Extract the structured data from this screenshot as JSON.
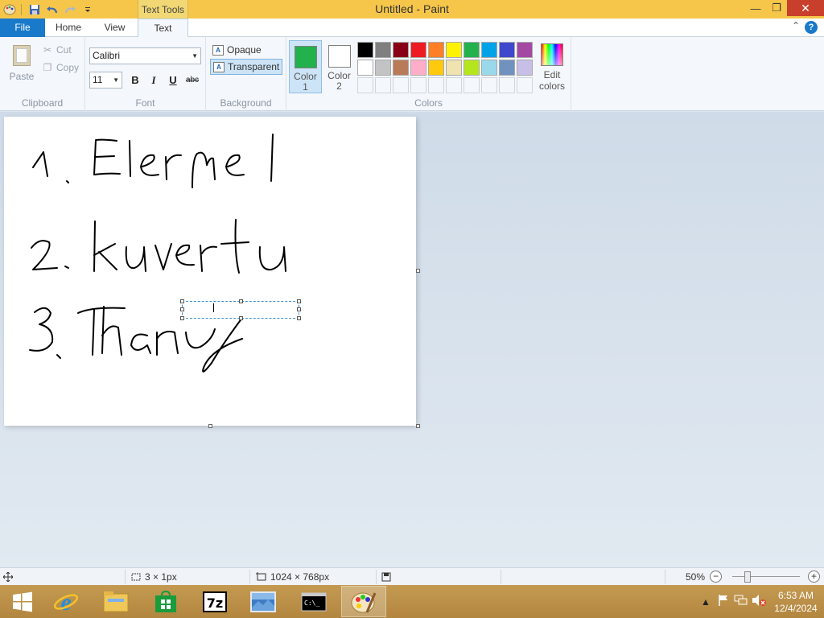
{
  "window": {
    "title": "Untitled - Paint",
    "context_tab_header": "Text Tools",
    "minimize": "—",
    "maximize": "❐",
    "close": "✕"
  },
  "tabs": {
    "file": "File",
    "home": "Home",
    "view": "View",
    "text": "Text",
    "help": "?",
    "collapse": "⌃"
  },
  "ribbon": {
    "clipboard": {
      "label": "Clipboard",
      "paste": "Paste",
      "cut": "Cut",
      "copy": "Copy"
    },
    "font": {
      "label": "Font",
      "name": "Calibri",
      "size": "11",
      "bold": "B",
      "italic": "I",
      "underline": "U",
      "strike": "abc"
    },
    "background": {
      "label": "Background",
      "opaque": "Opaque",
      "transparent": "Transparent"
    },
    "colors": {
      "label": "Colors",
      "color1_label": "Color 1",
      "color1_line1": "Color",
      "color1_line2": "1",
      "color2_line1": "Color",
      "color2_line2": "2",
      "color1": "#22b14c",
      "color2": "#ffffff",
      "edit_line1": "Edit",
      "edit_line2": "colors",
      "palette_row1": [
        "#000000",
        "#7f7f7f",
        "#880015",
        "#ed1c24",
        "#ff7f27",
        "#fff200",
        "#22b14c",
        "#00a2e8",
        "#3f48cc",
        "#a349a4"
      ],
      "palette_row2": [
        "#ffffff",
        "#c3c3c3",
        "#b97a57",
        "#ffaec9",
        "#ffc90e",
        "#efe4b0",
        "#b5e61d",
        "#99d9ea",
        "#7092be",
        "#c8bfe7"
      ]
    }
  },
  "status": {
    "selection_size": "3 × 1px",
    "image_size": "1024 × 768px",
    "zoom": "50%"
  },
  "clock": {
    "time": "6:53 AM",
    "date": "12/4/2024"
  },
  "icons": {
    "paint": "paint-app-icon",
    "save": "save-icon",
    "undo": "undo-icon",
    "redo": "redo-icon"
  }
}
